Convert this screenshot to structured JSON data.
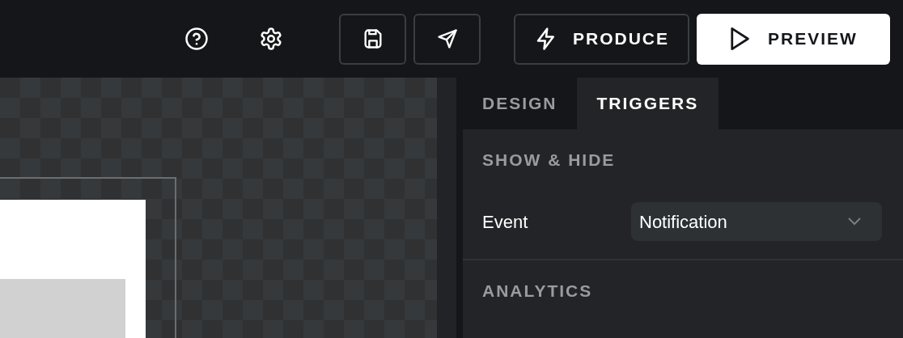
{
  "toolbar": {
    "icon_buttons": [
      {
        "kind": "help"
      },
      {
        "kind": "settings"
      }
    ],
    "outlined_buttons": [
      {
        "kind": "save"
      },
      {
        "kind": "send"
      }
    ],
    "produce": {
      "label": "PRODUCE"
    },
    "preview": {
      "label": "PREVIEW"
    }
  },
  "tabs": [
    {
      "label": "DESIGN",
      "selected": false
    },
    {
      "label": "TRIGGERS",
      "selected": true
    }
  ],
  "sections": [
    {
      "title": "SHOW & HIDE",
      "fields": [
        {
          "label": "Event",
          "value": "Notification"
        }
      ]
    },
    {
      "title": "ANALYTICS"
    }
  ]
}
